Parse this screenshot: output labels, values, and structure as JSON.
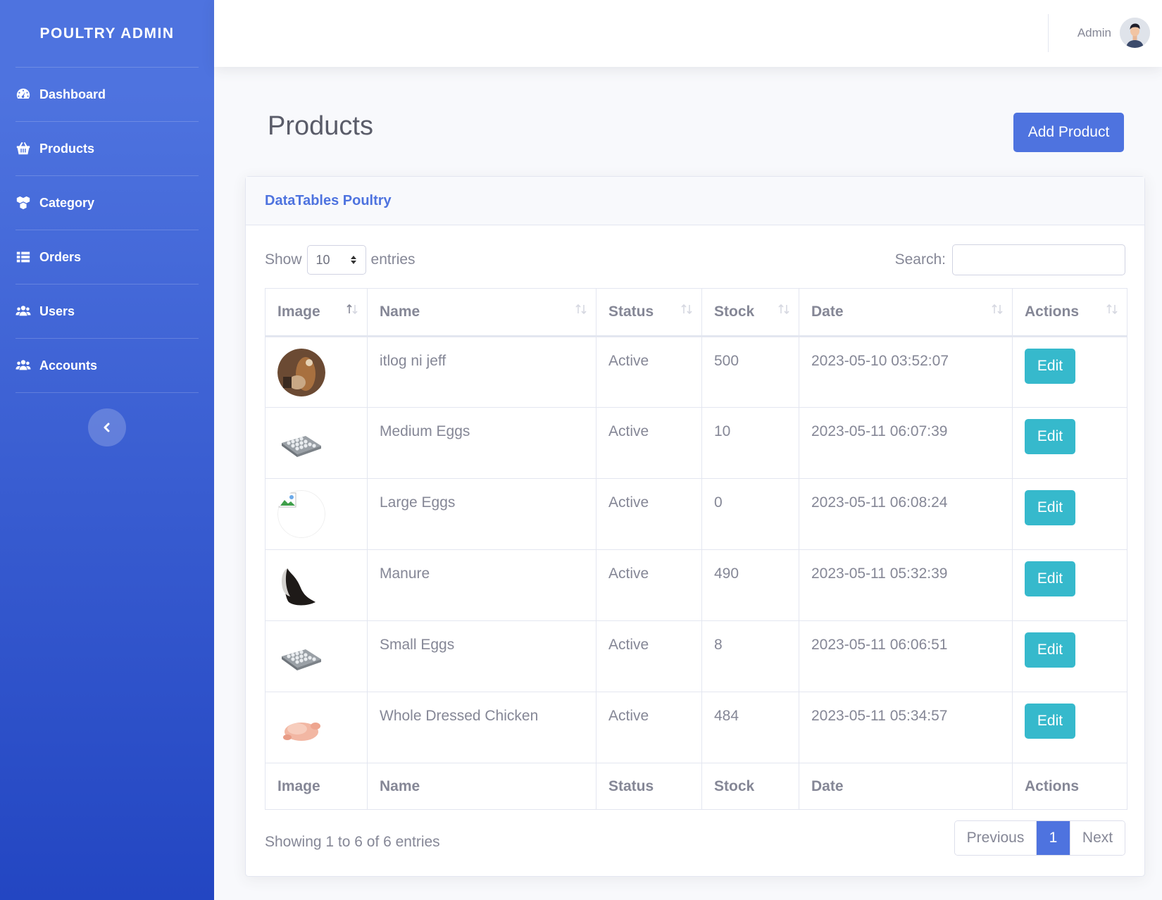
{
  "sidebar": {
    "brand": "POULTRY ADMIN",
    "items": [
      {
        "label": "Dashboard",
        "icon": "tachometer-icon"
      },
      {
        "label": "Products",
        "icon": "shopping-basket-icon"
      },
      {
        "label": "Category",
        "icon": "boxes-icon"
      },
      {
        "label": "Orders",
        "icon": "list-icon"
      },
      {
        "label": "Users",
        "icon": "users-icon"
      },
      {
        "label": "Accounts",
        "icon": "users-icon"
      }
    ],
    "toggle_icon": "chevron-left-icon"
  },
  "topbar": {
    "user_name": "Admin"
  },
  "page": {
    "title": "Products",
    "add_button": "Add Product"
  },
  "card": {
    "title": "DataTables Poultry",
    "show_label": "Show",
    "entries_label": "entries",
    "page_length": "10",
    "search_label": "Search:",
    "search_value": ""
  },
  "table": {
    "columns": [
      "Image",
      "Name",
      "Status",
      "Stock",
      "Date",
      "Actions"
    ],
    "rows": [
      {
        "image": "chicken-photo",
        "name": "itlog ni jeff",
        "status": "Active",
        "stock": "500",
        "date": "2023-05-10 03:52:07",
        "action": "Edit"
      },
      {
        "image": "egg-tray",
        "name": "Medium Eggs",
        "status": "Active",
        "stock": "10",
        "date": "2023-05-11 06:07:39",
        "action": "Edit"
      },
      {
        "image": "broken-image",
        "name": "Large Eggs",
        "status": "Active",
        "stock": "0",
        "date": "2023-05-11 06:08:24",
        "action": "Edit"
      },
      {
        "image": "manure-bag",
        "name": "Manure",
        "status": "Active",
        "stock": "490",
        "date": "2023-05-11 05:32:39",
        "action": "Edit"
      },
      {
        "image": "egg-tray",
        "name": "Small Eggs",
        "status": "Active",
        "stock": "8",
        "date": "2023-05-11 06:06:51",
        "action": "Edit"
      },
      {
        "image": "dressed-chicken",
        "name": "Whole Dressed Chicken",
        "status": "Active",
        "stock": "484",
        "date": "2023-05-11 05:34:57",
        "action": "Edit"
      }
    ],
    "info": "Showing 1 to 6 of 6 entries"
  },
  "pagination": {
    "previous": "Previous",
    "current": "1",
    "next": "Next"
  },
  "colors": {
    "primary": "#4e73df",
    "info": "#36b9cc",
    "text": "#858796"
  }
}
